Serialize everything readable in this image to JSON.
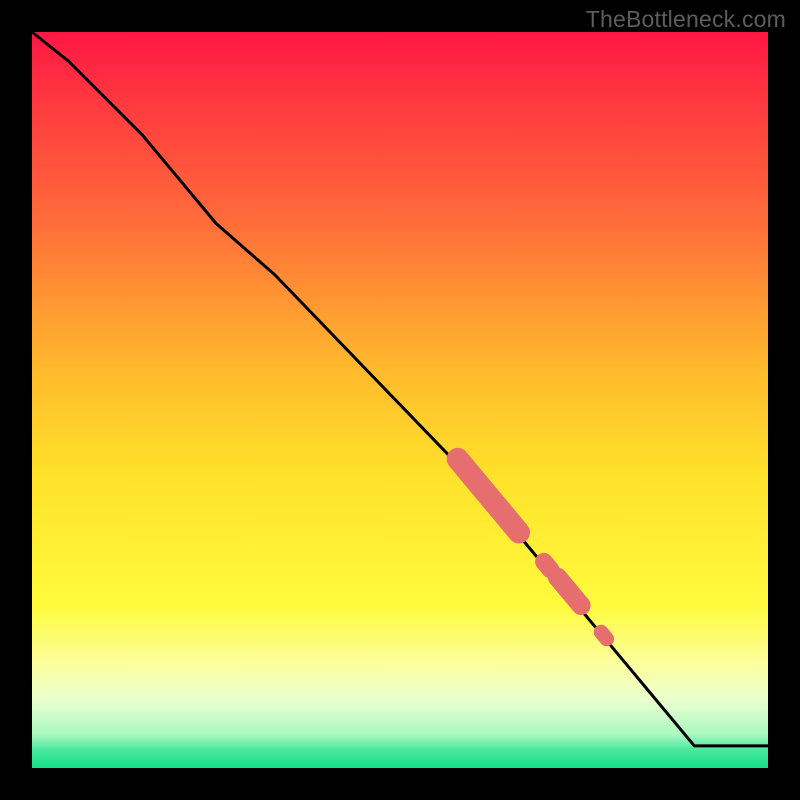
{
  "watermark": "TheBottleneck.com",
  "colors": {
    "frame": "#000000",
    "line": "#000000",
    "marker": "#e76e6e",
    "gradient_stops": [
      {
        "pos": 0.0,
        "color": "#ff1744"
      },
      {
        "pos": 0.1,
        "color": "#ff3a3f"
      },
      {
        "pos": 0.25,
        "color": "#ff6a3a"
      },
      {
        "pos": 0.45,
        "color": "#ffb72d"
      },
      {
        "pos": 0.6,
        "color": "#ffe12a"
      },
      {
        "pos": 0.78,
        "color": "#fffb3d"
      },
      {
        "pos": 0.86,
        "color": "#fbffa0"
      },
      {
        "pos": 0.91,
        "color": "#e8ffd0"
      },
      {
        "pos": 0.955,
        "color": "#a8f9c0"
      },
      {
        "pos": 0.975,
        "color": "#4be89d"
      },
      {
        "pos": 1.0,
        "color": "#13e08b"
      }
    ]
  },
  "chart_data": {
    "type": "line",
    "title": "",
    "xlabel": "",
    "ylabel": "",
    "xlim": [
      0,
      100
    ],
    "ylim": [
      0,
      100
    ],
    "grid": false,
    "series": [
      {
        "name": "curve",
        "x": [
          0,
          5,
          15,
          25,
          33,
          60,
          85,
          90,
          100
        ],
        "y": [
          100,
          96,
          86,
          74,
          67,
          39,
          9,
          3,
          3
        ]
      }
    ],
    "markers": [
      {
        "name": "segment-a",
        "type": "pill",
        "x_center": 62.0,
        "y_center": 37.0,
        "length": 13.0,
        "radius": 1.5
      },
      {
        "name": "dot-a",
        "type": "pill",
        "x_center": 70.0,
        "y_center": 27.5,
        "length": 1.4,
        "radius": 1.2
      },
      {
        "name": "segment-b",
        "type": "pill",
        "x_center": 73.0,
        "y_center": 24.0,
        "length": 5.0,
        "radius": 1.3
      },
      {
        "name": "dot-b",
        "type": "pill",
        "x_center": 77.7,
        "y_center": 18.0,
        "length": 1.2,
        "radius": 1.0
      }
    ]
  }
}
